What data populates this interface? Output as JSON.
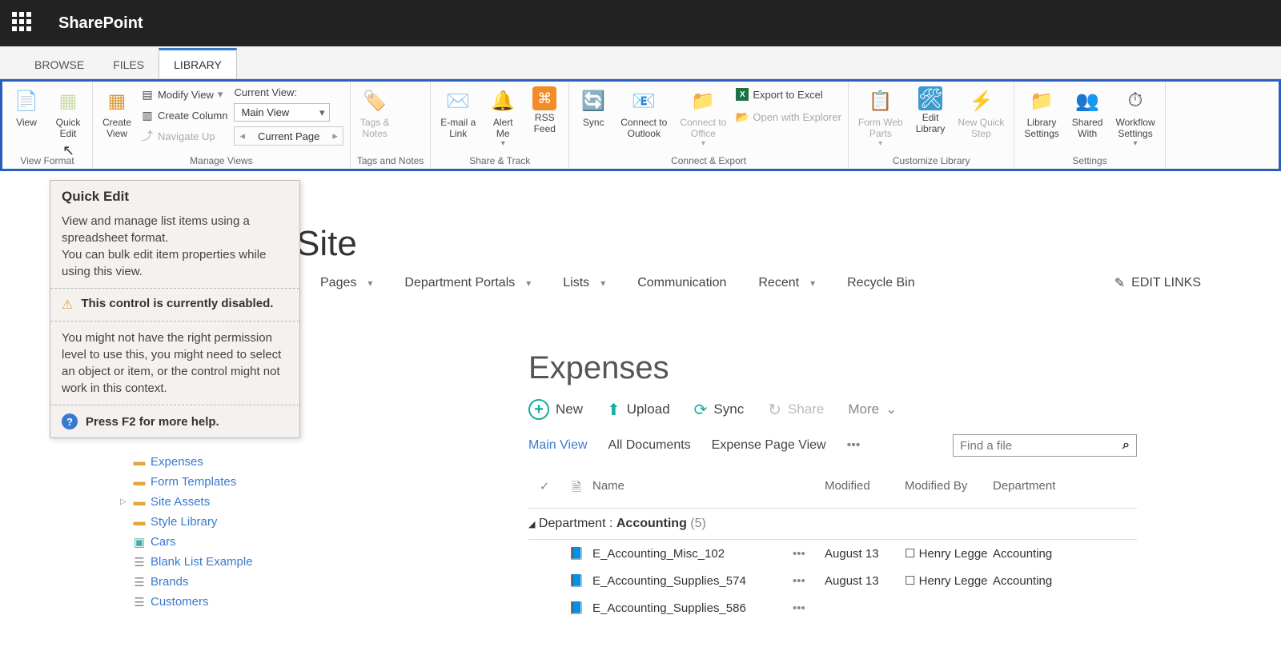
{
  "topbar": {
    "title": "SharePoint"
  },
  "tabs": {
    "browse": "BROWSE",
    "files": "FILES",
    "library": "LIBRARY"
  },
  "ribbon": {
    "view": "View",
    "quick_edit": "Quick\nEdit",
    "view_format": "View Format",
    "create_view": "Create\nView",
    "modify_view": "Modify View",
    "create_column": "Create Column",
    "navigate_up": "Navigate Up",
    "current_view_lbl": "Current View:",
    "main_view": "Main View",
    "current_page": "Current Page",
    "manage_views": "Manage Views",
    "tags_notes": "Tags &\nNotes",
    "tags_and_notes": "Tags and Notes",
    "email_link": "E-mail a\nLink",
    "alert_me": "Alert\nMe",
    "rss_feed": "RSS\nFeed",
    "share_track": "Share & Track",
    "sync": "Sync",
    "connect_outlook": "Connect to\nOutlook",
    "connect_office": "Connect to\nOffice",
    "export_excel": "Export to Excel",
    "open_explorer": "Open with Explorer",
    "connect_export": "Connect & Export",
    "form_web_parts": "Form Web\nParts",
    "edit_library": "Edit\nLibrary",
    "new_quick_step": "New Quick\nStep",
    "customize_library": "Customize Library",
    "library_settings": "Library\nSettings",
    "shared_with": "Shared\nWith",
    "workflow_settings": "Workflow\nSettings",
    "settings": "Settings"
  },
  "tooltip": {
    "title": "Quick Edit",
    "desc1": "View and manage list items using a spreadsheet format.",
    "desc2": "You can bulk edit item properties while using this view.",
    "warn_title": "This control is currently disabled.",
    "warn_body": "You might not have the right permission level to use this, you might need to select an object or item, or the control might not work in this context.",
    "help": "Press F2 for more help."
  },
  "site_title": "Site",
  "hnav": {
    "pages": "Pages",
    "dept": "Department Portals",
    "lists": "Lists",
    "comm": "Communication",
    "recent": "Recent",
    "recycle": "Recycle Bin",
    "edit": "EDIT LINKS"
  },
  "leftnav": {
    "expenses": "Expenses",
    "form_templates": "Form Templates",
    "site_assets": "Site Assets",
    "style_library": "Style Library",
    "cars": "Cars",
    "blank_list": "Blank List Example",
    "brands": "Brands",
    "customers": "Customers"
  },
  "main": {
    "title": "Expenses",
    "actions": {
      "new": "New",
      "upload": "Upload",
      "sync": "Sync",
      "share": "Share",
      "more": "More"
    },
    "views": {
      "main": "Main View",
      "all": "All Documents",
      "expense_page": "Expense Page View"
    },
    "search_placeholder": "Find a file",
    "cols": {
      "name": "Name",
      "modified": "Modified",
      "modified_by": "Modified By",
      "department": "Department"
    },
    "group": {
      "label": "Department : ",
      "value": "Accounting",
      "count": "(5)"
    },
    "rows": [
      {
        "name": "E_Accounting_Misc_102",
        "modified": "August 13",
        "by": "Henry Legge",
        "dept": "Accounting"
      },
      {
        "name": "E_Accounting_Supplies_574",
        "modified": "August 13",
        "by": "Henry Legge",
        "dept": "Accounting"
      },
      {
        "name": "E_Accounting_Supplies_586",
        "modified": "",
        "by": "",
        "dept": ""
      }
    ]
  }
}
